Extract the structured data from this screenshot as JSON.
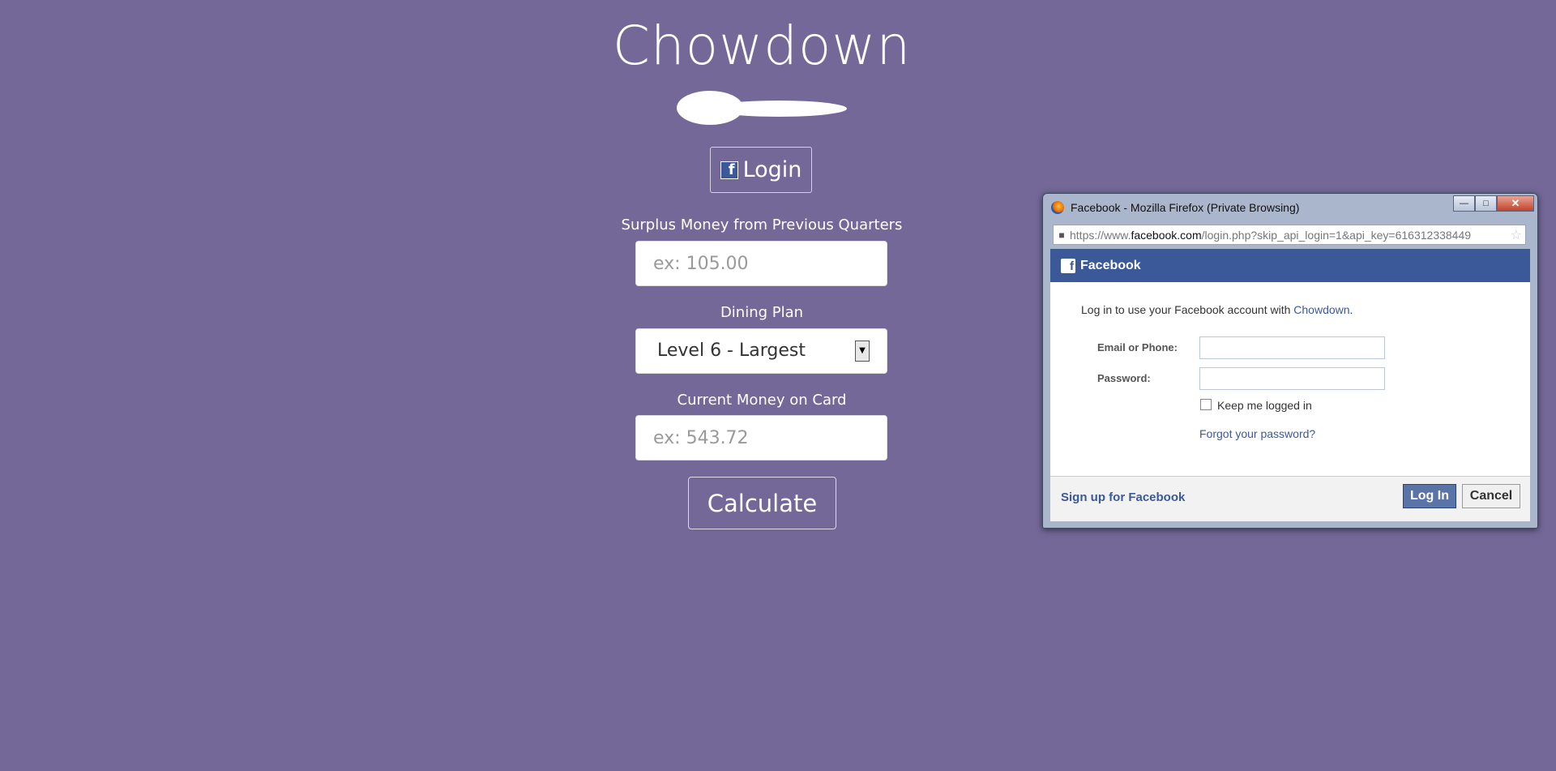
{
  "app": {
    "title": "Chowdown",
    "login_button": "Login",
    "fb_letter": "f",
    "surplus": {
      "label": "Surplus Money from Previous Quarters",
      "placeholder": "ex: 105.00"
    },
    "dining_plan": {
      "label": "Dining Plan",
      "selected": "Level 6 - Largest",
      "arrow": "▼"
    },
    "current_money": {
      "label": "Current Money on Card",
      "placeholder": "ex: 543.72"
    },
    "calculate_button": "Calculate"
  },
  "popup": {
    "window_title": "Facebook - Mozilla Firefox (Private Browsing)",
    "controls": {
      "minimize": "—",
      "maximize": "□",
      "close": "✕"
    },
    "url": {
      "prefix": "https://www.",
      "domain": "facebook.com",
      "path": "/login.php?skip_api_login=1&api_key=616312338449"
    },
    "header": "Facebook",
    "intro_text": "Log in to use your Facebook account with ",
    "intro_app": "Chowdown",
    "intro_suffix": ".",
    "email_label": "Email or Phone:",
    "password_label": "Password:",
    "keep_logged_in": "Keep me logged in",
    "forgot_password": "Forgot your password?",
    "signup_link": "Sign up for Facebook",
    "login_btn": "Log In",
    "cancel_btn": "Cancel"
  },
  "colors": {
    "background": "#736897",
    "facebook_blue": "#3b5998"
  }
}
